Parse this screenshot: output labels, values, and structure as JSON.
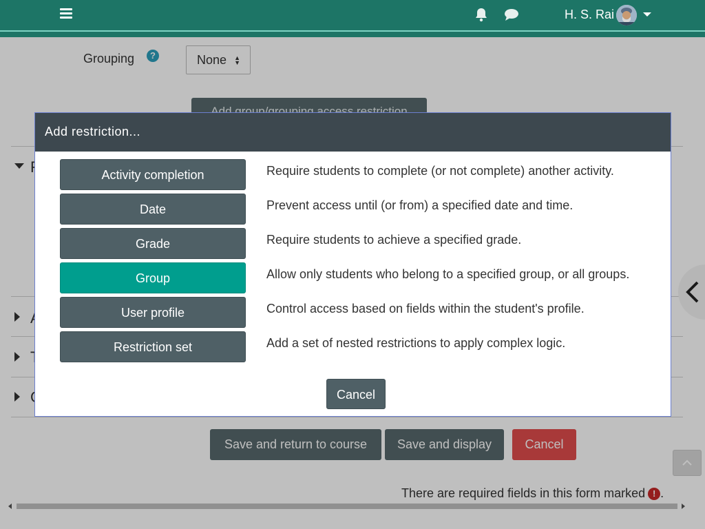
{
  "navbar": {
    "user_name": "H. S. Rai",
    "icons": [
      "menu-icon",
      "bell-icon",
      "chat-icon",
      "avatar",
      "chevron-down-icon"
    ]
  },
  "form": {
    "grouping_label": "Grouping",
    "grouping_value": "None",
    "add_group_button": "Add group/grouping access restriction",
    "section_letters": [
      "F",
      "A",
      "T",
      "C"
    ],
    "buttons": {
      "save_return": "Save and return to course",
      "save_display": "Save and display",
      "cancel": "Cancel"
    },
    "required_note": "There are required fields in this form marked",
    "required_note_end": "."
  },
  "modal": {
    "title": "Add restriction...",
    "options": [
      {
        "label": "Activity completion",
        "description": "Require students to complete (or not complete) another activity."
      },
      {
        "label": "Date",
        "description": "Prevent access until (or from) a specified date and time."
      },
      {
        "label": "Grade",
        "description": "Require students to achieve a specified grade."
      },
      {
        "label": "Group",
        "description": "Allow only students who belong to a specified group, or all groups."
      },
      {
        "label": "User profile",
        "description": "Control access based on fields within the student's profile."
      },
      {
        "label": "Restriction set",
        "description": "Add a set of nested restrictions to apply complex logic."
      }
    ],
    "active_option": "Group",
    "cancel_label": "Cancel"
  },
  "colors": {
    "navbar": "#1d7566",
    "button": "#4f6066",
    "active": "#009e8e",
    "danger": "#e14c4c"
  }
}
